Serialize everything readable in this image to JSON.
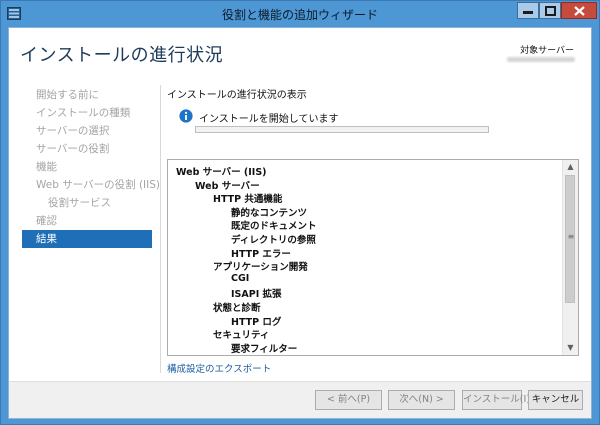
{
  "window": {
    "title": "役割と機能の追加ウィザード"
  },
  "page": {
    "title": "インストールの進行状況",
    "target_server_label": "対象サーバー"
  },
  "nav": {
    "items": [
      {
        "label": "開始する前に",
        "state": "disabled"
      },
      {
        "label": "インストールの種類",
        "state": "disabled"
      },
      {
        "label": "サーバーの選択",
        "state": "disabled"
      },
      {
        "label": "サーバーの役割",
        "state": "disabled"
      },
      {
        "label": "機能",
        "state": "disabled"
      },
      {
        "label": "Web サーバーの役割 (IIS)",
        "state": "disabled"
      },
      {
        "label": "役割サービス",
        "state": "disabled"
      },
      {
        "label": "確認",
        "state": "disabled"
      },
      {
        "label": "結果",
        "state": "active"
      }
    ]
  },
  "main": {
    "section_header": "インストールの進行状況の表示",
    "status_text": "インストールを開始しています",
    "progress_fraction": 0.0,
    "progress_color": "#06b025",
    "status_icon": "info-icon",
    "tree": [
      {
        "label": "Web サーバー (IIS)",
        "level": 0
      },
      {
        "label": "Web サーバー",
        "level": 1
      },
      {
        "label": "HTTP 共通機能",
        "level": 2
      },
      {
        "label": "静的なコンテンツ",
        "level": 3
      },
      {
        "label": "既定のドキュメント",
        "level": 3
      },
      {
        "label": "ディレクトリの参照",
        "level": 3
      },
      {
        "label": "HTTP エラー",
        "level": 3
      },
      {
        "label": "アプリケーション開発",
        "level": 2
      },
      {
        "label": "CGI",
        "level": 3
      },
      {
        "label": "ISAPI 拡張",
        "level": 3
      },
      {
        "label": "状態と診断",
        "level": 2
      },
      {
        "label": "HTTP ログ",
        "level": 3
      },
      {
        "label": "セキュリティ",
        "level": 2
      },
      {
        "label": "要求フィルター",
        "level": 3
      }
    ],
    "export_link": "構成設定のエクスポート"
  },
  "footer": {
    "prev_label": "< 前へ(P)",
    "next_label": "次へ(N) >",
    "install_label": "インストール(I)",
    "cancel_label": "キャンセル"
  },
  "colors": {
    "titlebar": "#4d97d4",
    "nav_active_bg": "#1e6eb8",
    "close_button": "#c74b3c"
  }
}
